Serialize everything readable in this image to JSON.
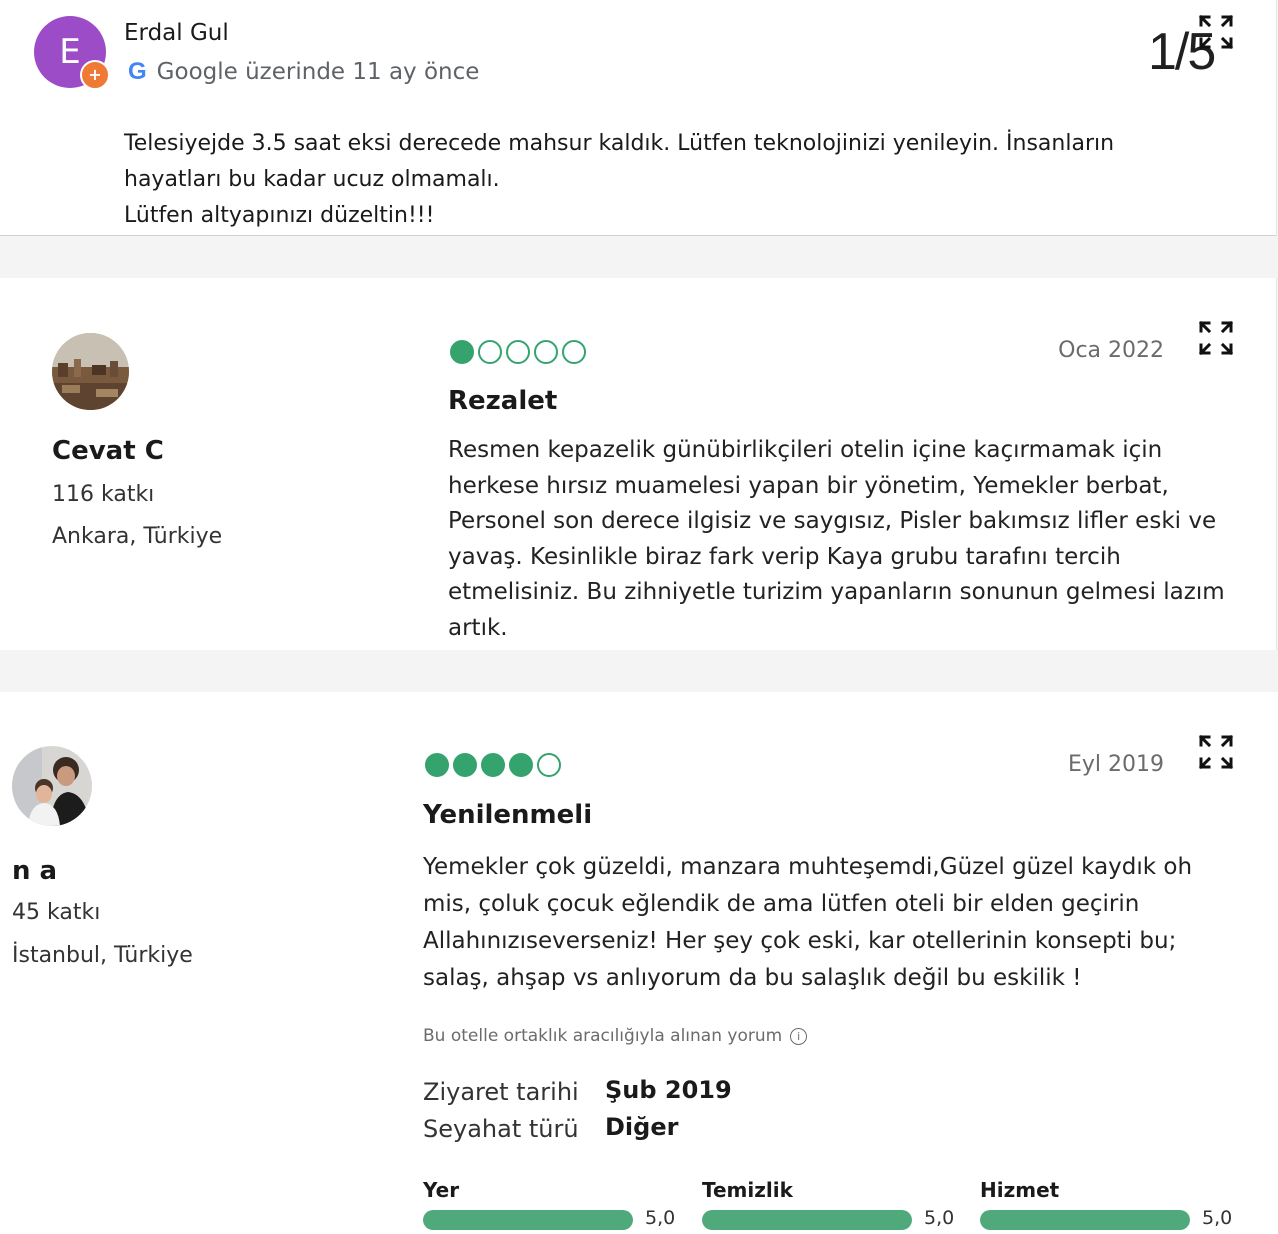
{
  "google_review": {
    "avatar_letter": "E",
    "avatar_color": "#9d4cc7",
    "badge_glyph": "+",
    "name": "Erdal Gul",
    "source_logo": "G",
    "source": "Google üzerinde 11 ay önce",
    "counter": "1/5",
    "text_lines": [
      "Telesiyejde 3.5 saat eksi derecede mahsur kaldık. Lütfen teknolojinizi yenileyin. İnsanların",
      "hayatları bu kadar ucuz olmamalı.",
      "Lütfen altyapınızı düzeltin!!!"
    ]
  },
  "reviews": [
    {
      "user": "Cevat C",
      "contributions": "116 katkı",
      "location": "Ankara, Türkiye",
      "rating": 1,
      "rating_max": 5,
      "date": "Oca 2022",
      "title": "Rezalet",
      "body_lines": [
        "Resmen kepazelik günübirlikçileri otelin içine kaçırmamak için",
        "herkese hırsız muamelesi yapan bir yönetim, Yemekler berbat,",
        "Personel son derece ilgisiz ve saygısız, Pisler bakımsız lifler eski ve",
        "yavaş. Kesinlikle biraz fark verip Kaya grubu tarafını tercih",
        "etmelisiniz. Bu zihniyetle turizim yapanların sonunun gelmesi lazım",
        "artık."
      ]
    },
    {
      "user": "n a",
      "contributions": "45 katkı",
      "location": "İstanbul, Türkiye",
      "rating": 4,
      "rating_max": 5,
      "date": "Eyl 2019",
      "title": "Yenilenmeli",
      "body_lines": [
        "Yemekler çok güzeldi, manzara muhteşemdi,Güzel güzel kaydık oh",
        "mis, çoluk çocuk eğlendik de ama lütfen oteli bir elden geçirin",
        "Allahınızıseverseniz! Her şey çok eski, kar otellerinin konsepti bu;",
        "salaş, ahşap vs anlıyorum da bu salaşlık değil bu eskilik !"
      ],
      "partner_note": "Bu otelle ortaklık aracılığıyla alınan yorum",
      "partner_info_glyph": "i",
      "visit_label": "Ziyaret tarihi",
      "visit_value": "Şub 2019",
      "trip_label": "Seyahat türü",
      "trip_value": "Diğer",
      "subratings": [
        {
          "label": "Yer",
          "score": "5,0",
          "fraction": 1.0
        },
        {
          "label": "Temizlik",
          "score": "5,0",
          "fraction": 1.0
        },
        {
          "label": "Hizmet",
          "score": "5,0",
          "fraction": 1.0
        }
      ]
    }
  ],
  "colors": {
    "bubble": "#34a36d",
    "bar": "#4fa97b"
  },
  "icons": [
    "expand-icon",
    "google-logo-icon",
    "local-guide-badge-icon",
    "info-icon"
  ]
}
